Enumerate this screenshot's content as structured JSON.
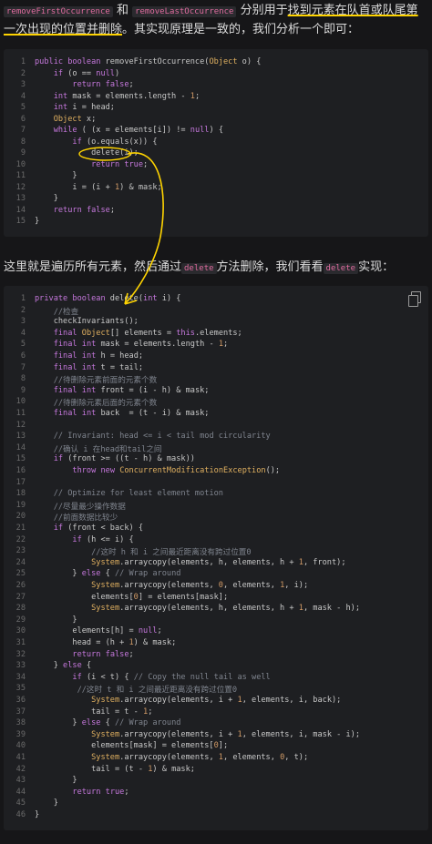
{
  "intro": {
    "code1": "removeFirstOccurrence",
    "and": "和",
    "code2": "removeLastOccurrence",
    "text_a": "分别用于",
    "text_hl": "找到元素在队首或队尾第一次出现的位置并删除",
    "text_b": "。其实现原理是一致的，我们分析一个即可："
  },
  "block1": {
    "lines": [
      "public boolean removeFirstOccurrence(Object o) {",
      "    if (o == null)",
      "        return false;",
      "    int mask = elements.length - 1;",
      "    int i = head;",
      "    Object x;",
      "    while ( (x = elements[i]) != null) {",
      "        if (o.equals(x)) {",
      "            delete(i);",
      "            return true;",
      "        }",
      "        i = (i + 1) & mask;",
      "    }",
      "    return false;",
      "}"
    ]
  },
  "mid": {
    "text_a": "这里就是遍历所有元素，然后通过",
    "code1": "delete",
    "text_b": "方法删除，我们看看",
    "code2": "delete",
    "text_c": "实现："
  },
  "block2": {
    "copy_icon": "copy-icon",
    "lines": [
      "private boolean delete(int i) {",
      "    //检查",
      "    checkInvariants();",
      "    final Object[] elements = this.elements;",
      "    final int mask = elements.length - 1;",
      "    final int h = head;",
      "    final int t = tail;",
      "    //待删除元素前面的元素个数",
      "    final int front = (i - h) & mask;",
      "    //待删除元素后面的元素个数",
      "    final int back  = (t - i) & mask;",
      "",
      "    // Invariant: head <= i < tail mod circularity",
      "    //确认 i 在head和tail之间",
      "    if (front >= ((t - h) & mask))",
      "        throw new ConcurrentModificationException();",
      "",
      "    // Optimize for least element motion",
      "    //尽量最少操作数据",
      "    //前面数据比较少",
      "    if (front < back) {",
      "        if (h <= i) {",
      "            //这时 h 和 i 之间最近距离没有跨过位置0",
      "            System.arraycopy(elements, h, elements, h + 1, front);",
      "        } else { // Wrap around",
      "            System.arraycopy(elements, 0, elements, 1, i);",
      "            elements[0] = elements[mask];",
      "            System.arraycopy(elements, h, elements, h + 1, mask - h);",
      "        }",
      "        elements[h] = null;",
      "        head = (h + 1) & mask;",
      "        return false;",
      "    } else {",
      "        if (i < t) { // Copy the null tail as well",
      "         //这时 t 和 i 之间最近距离没有跨过位置0",
      "            System.arraycopy(elements, i + 1, elements, i, back);",
      "            tail = t - 1;",
      "        } else { // Wrap around",
      "            System.arraycopy(elements, i + 1, elements, i, mask - i);",
      "            elements[mask] = elements[0];",
      "            System.arraycopy(elements, 1, elements, 0, t);",
      "            tail = (t - 1) & mask;",
      "        }",
      "        return true;",
      "    }",
      "}"
    ]
  }
}
